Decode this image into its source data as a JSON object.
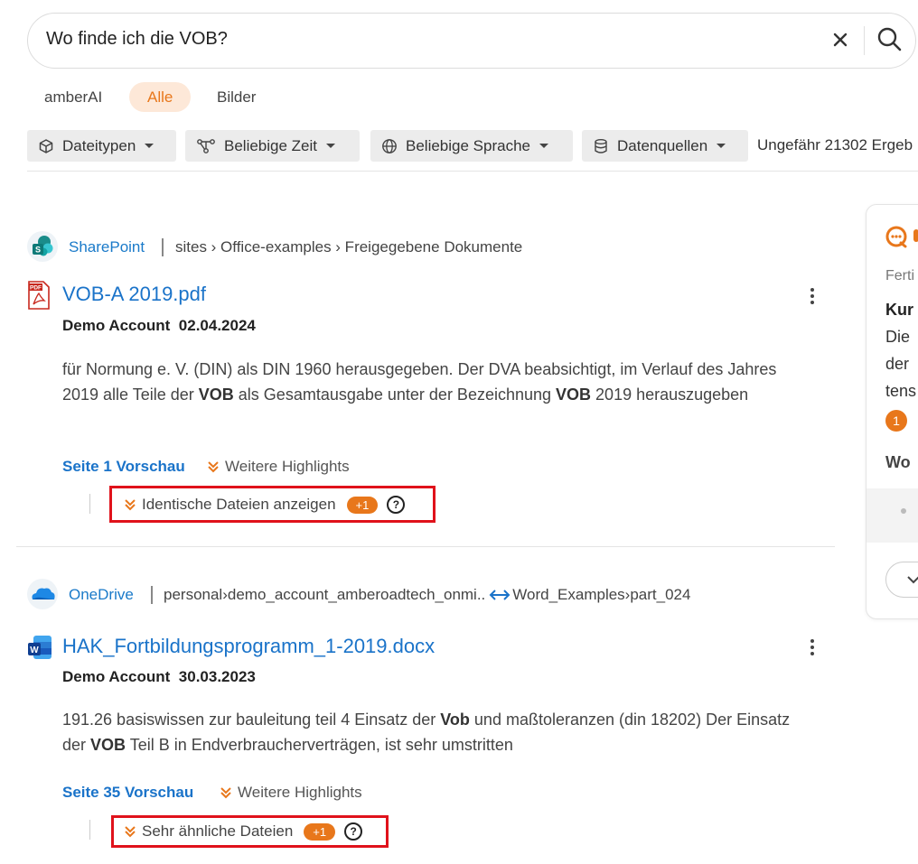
{
  "search": {
    "query": "Wo finde ich die VOB?"
  },
  "tabs": [
    {
      "label": "amberAI"
    },
    {
      "label": "Alle"
    },
    {
      "label": "Bilder"
    }
  ],
  "filters": [
    {
      "label": "Dateitypen",
      "icon": "cube-icon"
    },
    {
      "label": "Beliebige Zeit",
      "icon": "branch-icon"
    },
    {
      "label": "Beliebige Sprache",
      "icon": "globe-icon"
    },
    {
      "label": "Datenquellen",
      "icon": "database-icon"
    }
  ],
  "result_count": "Ungefähr 21302 Ergeb",
  "results": [
    {
      "source": "SharePoint",
      "path": "sites › Office-examples › Freigegebene Dokumente",
      "title": "VOB-A 2019.pdf",
      "author": "Demo Account",
      "date": "02.04.2024",
      "snippet_parts": [
        "für Normung e. V. (DIN) als DIN 1960 herausgegeben. Der DVA beabsichtigt, im Verlauf des Jahres 2019 alle Teile der ",
        "VOB",
        " als Gesamtausgabe unter der Bezeichnung ",
        "VOB",
        " 2019 herauszugeben"
      ],
      "preview_link": "Seite 1 Vorschau",
      "more_highlights": "Weitere Highlights",
      "duplicates_label": "Identische Dateien anzeigen",
      "duplicates_badge": "+1"
    },
    {
      "source": "OneDrive",
      "path_part1": "personal›demo_account_amberoadtech_onmi..",
      "path_part2": "Word_Examples›part_024",
      "title": "HAK_Fortbildungsprogramm_1-2019.docx",
      "author": "Demo Account",
      "date": "30.03.2023",
      "snippet_parts": [
        "191.26 basiswissen zur bauleitung teil 4 Einsatz der ",
        "Vob",
        " und maßtoleranzen (din 18202) Der Einsatz der ",
        "VOB",
        " Teil B in Endverbraucherverträgen, ist sehr umstritten"
      ],
      "preview_link": "Seite 35 Vorschau",
      "more_highlights": "Weitere Highlights",
      "duplicates_label": "Sehr ähnliche Dateien",
      "duplicates_badge": "+1"
    }
  ],
  "ai_panel": {
    "status": "Ferti",
    "heading": "Kur",
    "lines": [
      "Die",
      "der",
      "tens"
    ],
    "ref_badge": "1",
    "subheading": "Wo"
  },
  "colors": {
    "accent": "#e8771b",
    "link": "#1a73c9",
    "highlight_box": "#e0121b"
  }
}
